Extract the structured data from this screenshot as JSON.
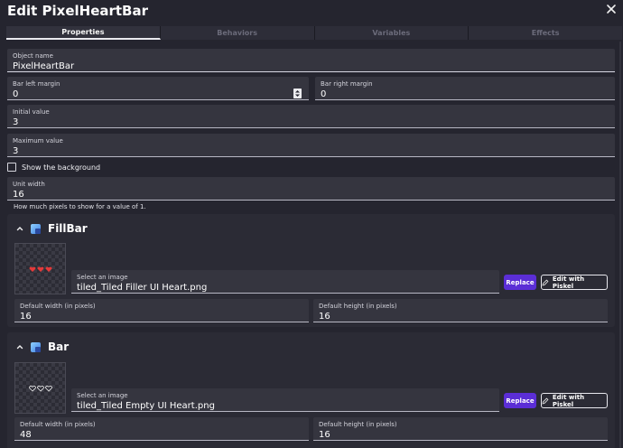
{
  "dialog": {
    "title": "Edit PixelHeartBar",
    "close_icon": "close-icon"
  },
  "tabs": [
    {
      "label": "Properties",
      "active": true
    },
    {
      "label": "Behaviors",
      "active": false
    },
    {
      "label": "Variables",
      "active": false
    },
    {
      "label": "Effects",
      "active": false
    }
  ],
  "fields": {
    "object_name": {
      "label": "Object name",
      "value": "PixelHeartBar"
    },
    "bar_left_margin": {
      "label": "Bar left margin",
      "value": "0"
    },
    "bar_right_margin": {
      "label": "Bar right margin",
      "value": "0"
    },
    "initial_value": {
      "label": "Initial value",
      "value": "3"
    },
    "maximum_value": {
      "label": "Maximum value",
      "value": "3"
    },
    "show_background": {
      "label": "Show the background",
      "checked": false
    },
    "unit_width": {
      "label": "Unit width",
      "value": "16",
      "help": "How much pixels to show for a value of 1."
    }
  },
  "sections": [
    {
      "title": "FillBar",
      "image_label": "Select an image",
      "image_value": "tiled_Tiled Filler UI Heart.png",
      "replace_label": "Replace",
      "piskel_label": "Edit with Piskel",
      "width_label": "Default width (in pixels)",
      "width_value": "16",
      "height_label": "Default height (in pixels)",
      "height_value": "16",
      "hearts": "filled"
    },
    {
      "title": "Bar",
      "image_label": "Select an image",
      "image_value": "tiled_Tiled Empty UI Heart.png",
      "replace_label": "Replace",
      "piskel_label": "Edit with Piskel",
      "width_label": "Default width (in pixels)",
      "width_value": "48",
      "height_label": "Default height (in pixels)",
      "height_value": "16",
      "hearts": "outline"
    }
  ],
  "colors": {
    "background": "#25252f",
    "field": "#35353f",
    "accent": "#5b2ed6",
    "heart": "#e53a3a"
  }
}
